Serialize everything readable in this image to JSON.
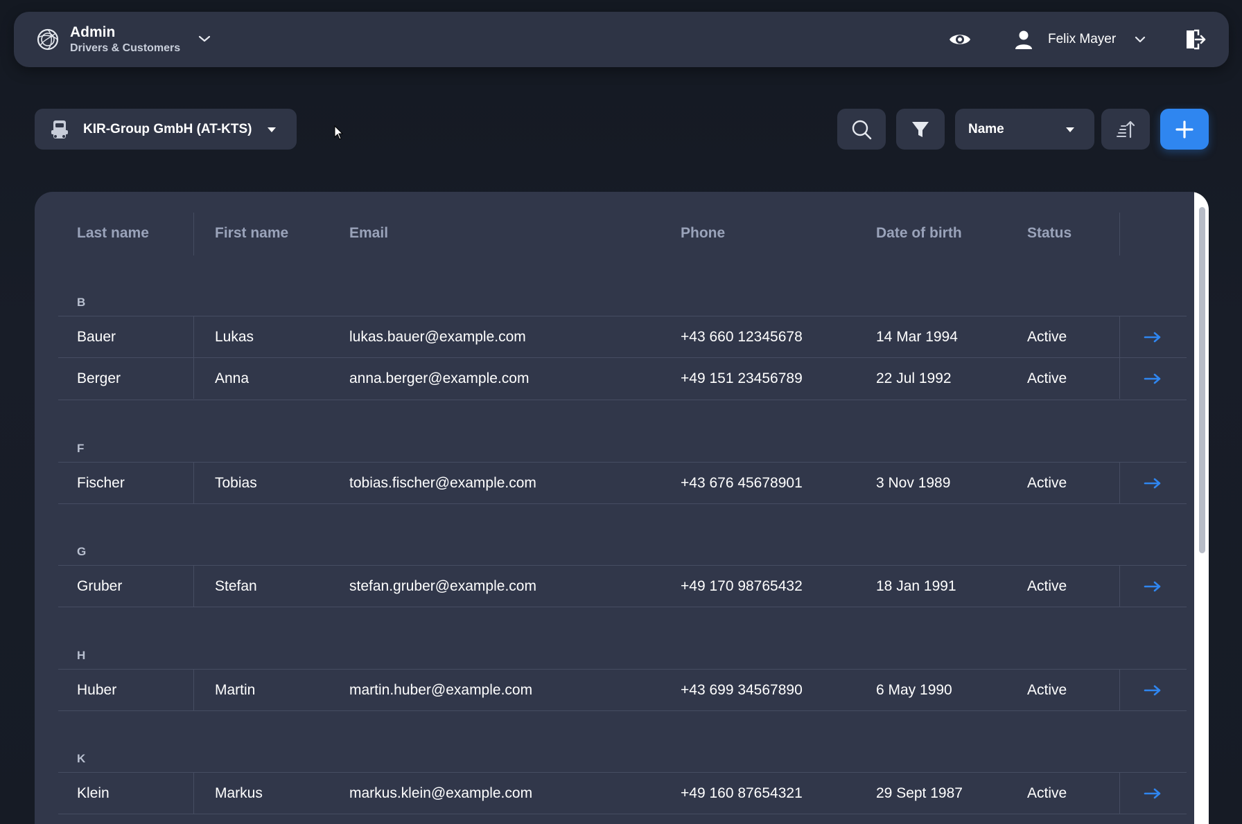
{
  "header": {
    "title": "Admin",
    "subtitle": "Drivers & Customers",
    "user_name": "Felix Mayer",
    "icons": {
      "logo": "aperture-logo-icon",
      "switch": "chevron-down-icon",
      "preview": "eye-icon",
      "user": "user-icon",
      "logout": "logout-icon"
    }
  },
  "toolbar": {
    "company": "KIR-Group GmbH (AT-KTS)",
    "sort_field": "Name",
    "accent_color": "#2f86f0"
  },
  "table": {
    "columns": {
      "last_name": "Last name",
      "first_name": "First name",
      "email": "Email",
      "phone": "Phone",
      "dob": "Date of birth",
      "status": "Status"
    },
    "groups": [
      {
        "letter": "B",
        "rows": [
          {
            "last": "Bauer",
            "first": "Lukas",
            "email": "lukas.bauer@example.com",
            "phone": "+43 660 12345678",
            "dob": "14 Mar 1994",
            "status": "Active"
          },
          {
            "last": "Berger",
            "first": "Anna",
            "email": "anna.berger@example.com",
            "phone": "+49 151 23456789",
            "dob": "22 Jul 1992",
            "status": "Active"
          }
        ]
      },
      {
        "letter": "F",
        "rows": [
          {
            "last": "Fischer",
            "first": "Tobias",
            "email": "tobias.fischer@example.com",
            "phone": "+43 676 45678901",
            "dob": "3 Nov 1989",
            "status": "Active"
          }
        ]
      },
      {
        "letter": "G",
        "rows": [
          {
            "last": "Gruber",
            "first": "Stefan",
            "email": "stefan.gruber@example.com",
            "phone": "+49 170 98765432",
            "dob": "18 Jan 1991",
            "status": "Active"
          }
        ]
      },
      {
        "letter": "H",
        "rows": [
          {
            "last": "Huber",
            "first": "Martin",
            "email": "martin.huber@example.com",
            "phone": "+43 699 34567890",
            "dob": "6 May 1990",
            "status": "Active"
          }
        ]
      },
      {
        "letter": "K",
        "rows": [
          {
            "last": "Klein",
            "first": "Markus",
            "email": "markus.klein@example.com",
            "phone": "+49 160 87654321",
            "dob": "29 Sept 1987",
            "status": "Active"
          }
        ]
      }
    ]
  }
}
